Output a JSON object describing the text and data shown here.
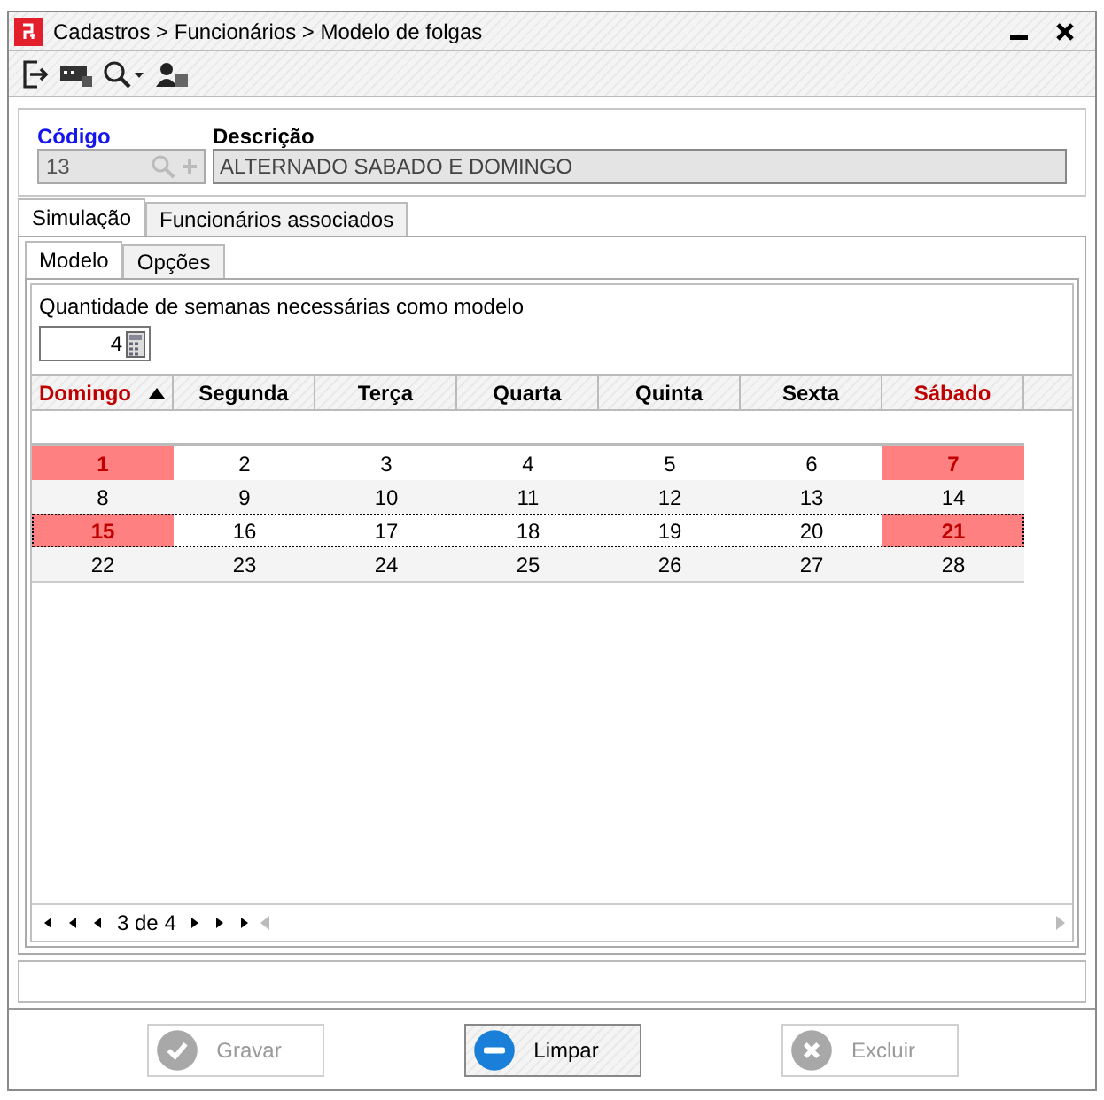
{
  "window": {
    "title": "Cadastros > Funcionários > Modelo de folgas"
  },
  "header": {
    "code_label": "Código",
    "code_value": "13",
    "description_label": "Descrição",
    "description_value": "ALTERNADO SABADO E DOMINGO"
  },
  "tabs": [
    {
      "label": "Simulação",
      "selected": true
    },
    {
      "label": "Funcionários associados",
      "selected": false
    }
  ],
  "subtabs": [
    {
      "label": "Modelo",
      "selected": true
    },
    {
      "label": "Opções",
      "selected": false
    }
  ],
  "weeks": {
    "label": "Quantidade de semanas necessárias como modelo",
    "value": "4"
  },
  "columns": [
    {
      "name": "Domingo",
      "weekend": true,
      "sorted": true
    },
    {
      "name": "Segunda",
      "weekend": false,
      "sorted": false
    },
    {
      "name": "Terça",
      "weekend": false,
      "sorted": false
    },
    {
      "name": "Quarta",
      "weekend": false,
      "sorted": false
    },
    {
      "name": "Quinta",
      "weekend": false,
      "sorted": false
    },
    {
      "name": "Sexta",
      "weekend": false,
      "sorted": false
    },
    {
      "name": "Sábado",
      "weekend": true,
      "sorted": false
    }
  ],
  "rows": [
    {
      "selected": false,
      "cells": [
        {
          "text": "1",
          "off": true
        },
        {
          "text": "2",
          "off": false
        },
        {
          "text": "3",
          "off": false
        },
        {
          "text": "4",
          "off": false
        },
        {
          "text": "5",
          "off": false
        },
        {
          "text": "6",
          "off": false
        },
        {
          "text": "7",
          "off": true
        }
      ]
    },
    {
      "selected": false,
      "cells": [
        {
          "text": "8",
          "off": false
        },
        {
          "text": "9",
          "off": false
        },
        {
          "text": "10",
          "off": false
        },
        {
          "text": "11",
          "off": false
        },
        {
          "text": "12",
          "off": false
        },
        {
          "text": "13",
          "off": false
        },
        {
          "text": "14",
          "off": false
        }
      ]
    },
    {
      "selected": true,
      "cells": [
        {
          "text": "15",
          "off": true
        },
        {
          "text": "16",
          "off": false
        },
        {
          "text": "17",
          "off": false
        },
        {
          "text": "18",
          "off": false
        },
        {
          "text": "19",
          "off": false
        },
        {
          "text": "20",
          "off": false
        },
        {
          "text": "21",
          "off": true
        }
      ]
    },
    {
      "selected": false,
      "cells": [
        {
          "text": "22",
          "off": false
        },
        {
          "text": "23",
          "off": false
        },
        {
          "text": "24",
          "off": false
        },
        {
          "text": "25",
          "off": false
        },
        {
          "text": "26",
          "off": false
        },
        {
          "text": "27",
          "off": false
        },
        {
          "text": "28",
          "off": false
        }
      ]
    }
  ],
  "pager": {
    "text": "3 de 4"
  },
  "buttons": [
    {
      "label": "Gravar",
      "kind": "save",
      "disabled": true
    },
    {
      "label": "Limpar",
      "kind": "clear",
      "disabled": false
    },
    {
      "label": "Excluir",
      "kind": "delete",
      "disabled": true
    }
  ]
}
